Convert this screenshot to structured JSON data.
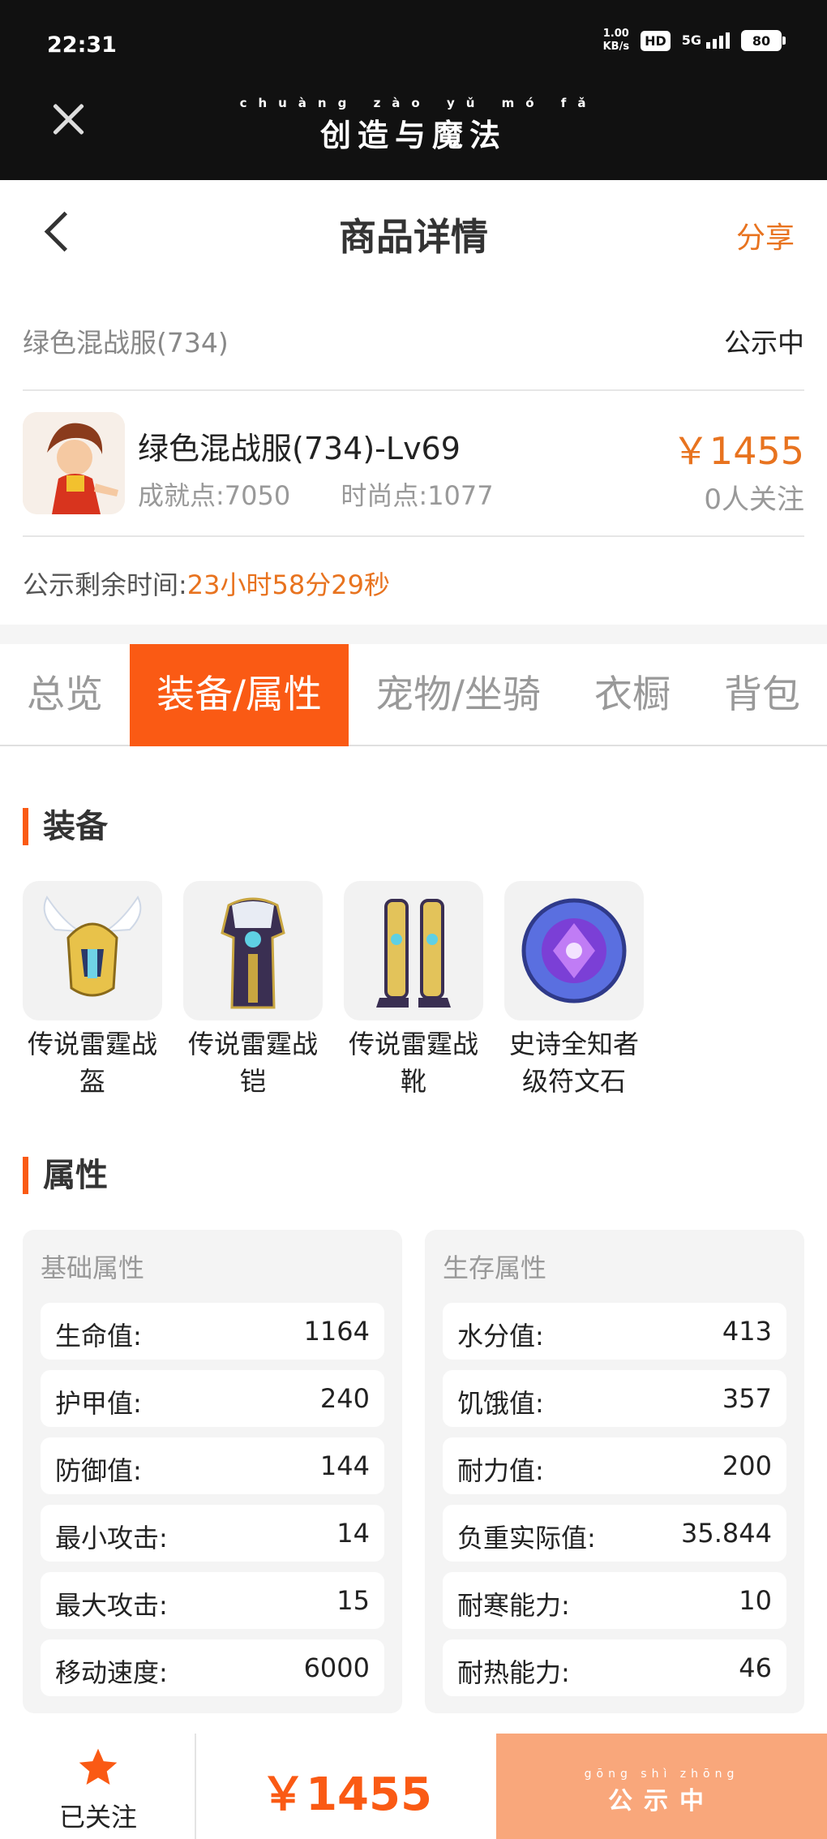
{
  "status_bar": {
    "time": "22:31",
    "speed_value": "1.00",
    "speed_unit": "KB/s",
    "hd": "HD",
    "network": "5G",
    "battery": "80"
  },
  "app_bar": {
    "pinyin": "chuàng zào yǔ mó fǎ",
    "title": "创造与魔法"
  },
  "nav": {
    "title": "商品详情",
    "share_label": "分享"
  },
  "product": {
    "short_name": "绿色混战服(734)",
    "status": "公示中",
    "full_name": "绿色混战服(734)-Lv69",
    "achievement": "成就点:7050",
    "fashion": "时尚点:1077",
    "price": "￥1455",
    "followers": "0人关注",
    "countdown_label": "公示剩余时间:",
    "countdown_value": "23小时58分29秒"
  },
  "tabs": [
    {
      "label": "总览",
      "active": false
    },
    {
      "label": "装备/属性",
      "active": true
    },
    {
      "label": "宠物/坐骑",
      "active": false
    },
    {
      "label": "衣橱",
      "active": false
    },
    {
      "label": "背包",
      "active": false
    }
  ],
  "equipment": {
    "title": "装备",
    "items": [
      {
        "name_line1": "传说雷霆战",
        "name_line2": "盔",
        "icon": "helmet-icon"
      },
      {
        "name_line1": "传说雷霆战",
        "name_line2": "铠",
        "icon": "armor-icon"
      },
      {
        "name_line1": "传说雷霆战",
        "name_line2": "靴",
        "icon": "boots-icon"
      },
      {
        "name_line1": "史诗全知者",
        "name_line2": "级符文石",
        "icon": "rune-stone-icon"
      }
    ]
  },
  "attributes": {
    "title": "属性",
    "basic": {
      "title": "基础属性",
      "rows": [
        {
          "key": "生命值:",
          "value": "1164"
        },
        {
          "key": "护甲值:",
          "value": "240"
        },
        {
          "key": "防御值:",
          "value": "144"
        },
        {
          "key": "最小攻击:",
          "value": "14"
        },
        {
          "key": "最大攻击:",
          "value": "15"
        },
        {
          "key": "移动速度:",
          "value": "6000"
        }
      ]
    },
    "survival": {
      "title": "生存属性",
      "rows": [
        {
          "key": "水分值:",
          "value": "413"
        },
        {
          "key": "饥饿值:",
          "value": "357"
        },
        {
          "key": "耐力值:",
          "value": "200"
        },
        {
          "key": "负重实际值:",
          "value": "35.844"
        },
        {
          "key": "耐寒能力:",
          "value": "10"
        },
        {
          "key": "耐热能力:",
          "value": "46"
        }
      ]
    }
  },
  "bottom_bar": {
    "follow_label": "已关注",
    "price": "￥1455",
    "status_pinyin": "gōng shì zhōng",
    "status_label": "公示中"
  },
  "colors": {
    "accent": "#fa5a14",
    "price": "#e8731f",
    "status_button": "#f9a77b",
    "topbar": "#111111"
  }
}
